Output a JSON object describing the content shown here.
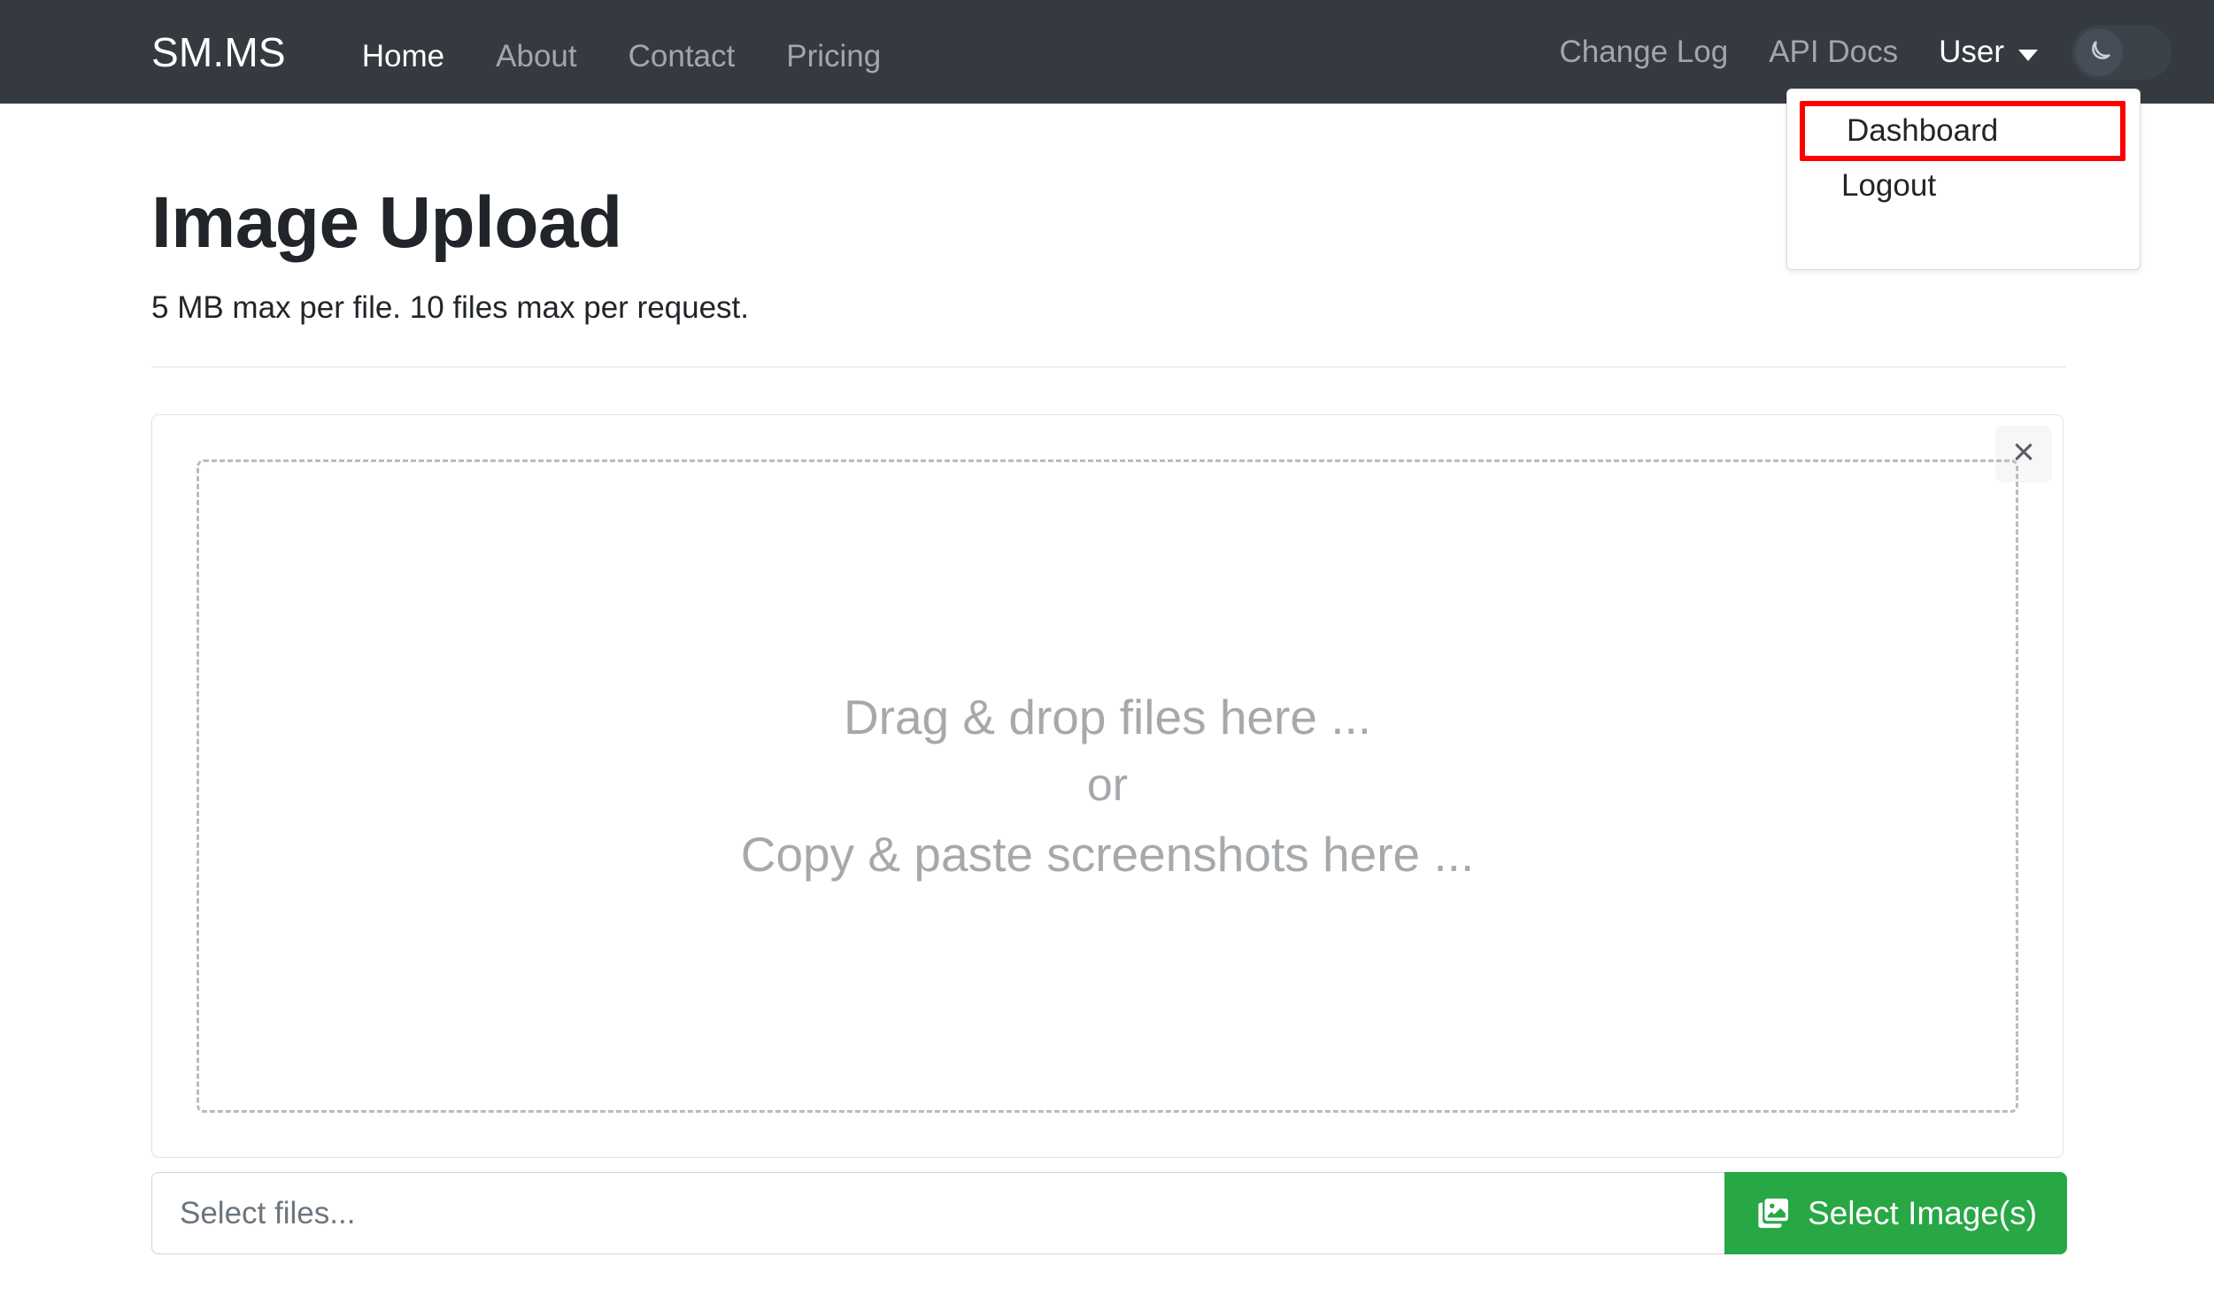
{
  "navbar": {
    "brand": "SM.MS",
    "links": [
      {
        "label": "Home",
        "active": true
      },
      {
        "label": "About",
        "active": false
      },
      {
        "label": "Contact",
        "active": false
      },
      {
        "label": "Pricing",
        "active": false
      }
    ],
    "right_links": [
      {
        "label": "Change Log"
      },
      {
        "label": "API Docs"
      }
    ],
    "user_menu": {
      "label": "User",
      "caret_icon": "chevron-down-icon",
      "items": [
        {
          "label": "Dashboard",
          "highlighted": true
        },
        {
          "label": "Logout",
          "highlighted": false
        }
      ]
    },
    "dark_mode_toggle": {
      "icon": "moon-icon",
      "state": "off"
    },
    "background_color": "#343a40"
  },
  "main": {
    "title": "Image Upload",
    "subtitle": "5 MB max per file. 10 files max per request.",
    "upload_card": {
      "close_icon": "close-icon",
      "dropzone": {
        "line1": "Drag & drop files here ...",
        "line2": "or",
        "line3": "Copy & paste screenshots here ..."
      }
    },
    "file_input": {
      "placeholder": "Select files...",
      "value": ""
    },
    "select_button": {
      "label": "Select Image(s)",
      "icon": "images-icon",
      "color": "#28a745"
    }
  },
  "colors": {
    "navbar_bg": "#343a40",
    "accent_green": "#28a745",
    "highlight_red": "#ff0000",
    "text_primary": "#212529",
    "text_muted": "#a6a9ac"
  }
}
